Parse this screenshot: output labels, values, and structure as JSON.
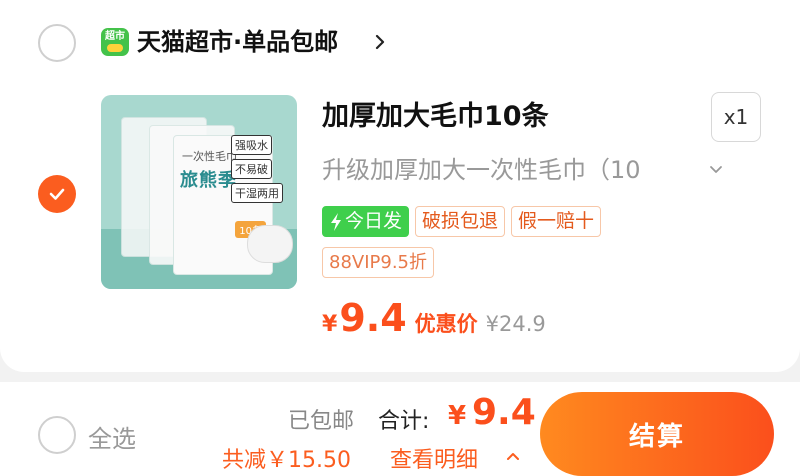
{
  "store": {
    "logo_text": "超市",
    "name": "天猫超市·单品包邮"
  },
  "product": {
    "title": "加厚加大毛巾10条",
    "quantity": "x1",
    "sku": "升级加厚加大一次性毛巾（10",
    "image": {
      "brand_text": "旅熊季",
      "type_text": "一次性毛巾",
      "tags": [
        "强吸水",
        "不易破",
        "干湿两用"
      ],
      "count_text": "10条"
    },
    "badges": [
      "今日发",
      "破损包退",
      "假一赔十"
    ],
    "vip_badge": "88VIP9.5折",
    "price": {
      "currency": "¥",
      "value": "9.4",
      "label": "优惠价",
      "original": "¥24.9"
    }
  },
  "footer": {
    "select_all": "全选",
    "shipping": "已包邮",
    "total_label": "合计:",
    "total_currency": "¥",
    "total_value": "9.4",
    "reduction": "共减￥15.50",
    "detail_link": "查看明细",
    "checkout": "结算"
  },
  "colors": {
    "accent": "#fb5d1f",
    "price": "#fb4f1c",
    "green_badge": "#3fcf4c"
  }
}
